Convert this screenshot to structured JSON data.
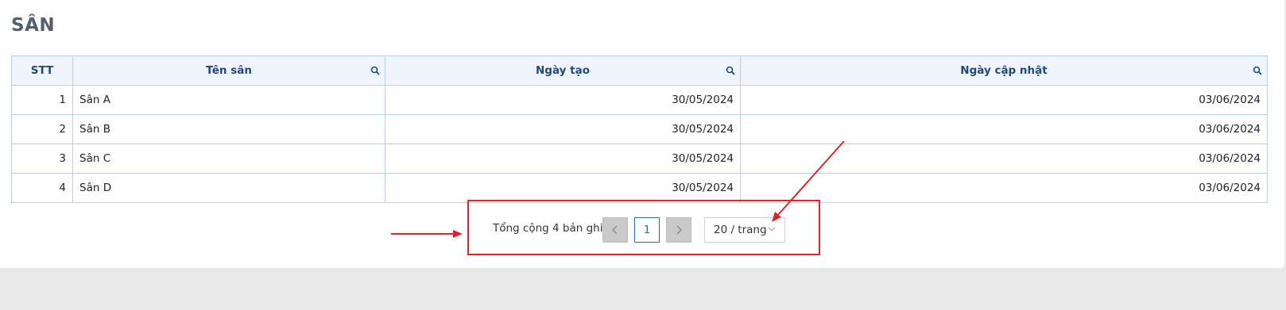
{
  "page": {
    "title": "SÂN"
  },
  "table": {
    "headers": [
      "STT",
      "Tên sân",
      "Ngày tạo",
      "Ngày cập nhật"
    ],
    "rows": [
      [
        "1",
        "Sân A",
        "30/05/2024",
        "03/06/2024"
      ],
      [
        "2",
        "Sân B",
        "30/05/2024",
        "03/06/2024"
      ],
      [
        "3",
        "Sân C",
        "30/05/2024",
        "03/06/2024"
      ],
      [
        "4",
        "Sân D",
        "30/05/2024",
        "03/06/2024"
      ]
    ]
  },
  "pagination": {
    "total_label": "Tổng cộng 4 bản ghi",
    "current_page": "1",
    "page_size": "20 / trang"
  },
  "colors": {
    "header_text": "#204a7a",
    "header_bg": "#f0f5fb",
    "border": "#b7d0e6",
    "annotation": "#d9262c"
  }
}
